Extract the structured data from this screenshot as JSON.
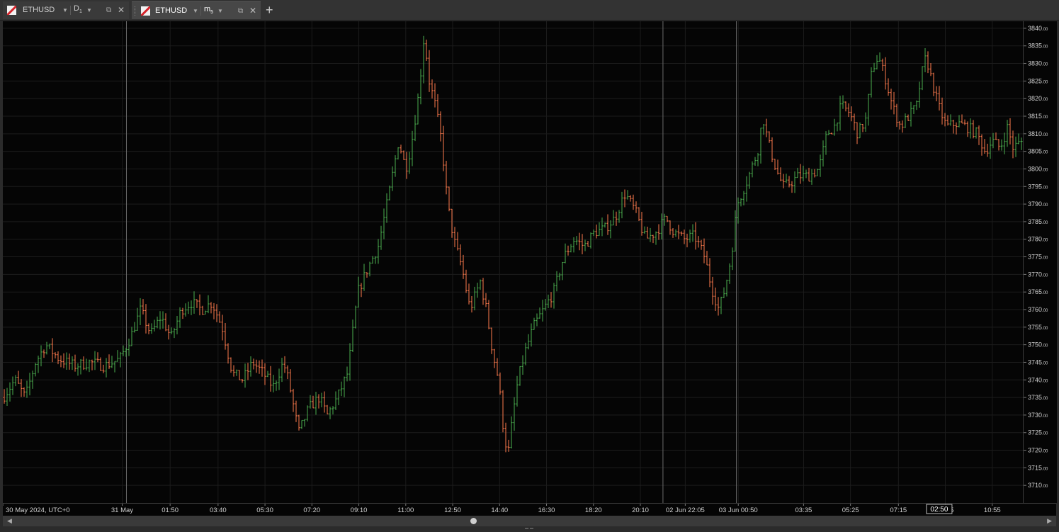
{
  "tabs": [
    {
      "symbol": "ETHUSD",
      "timeframe": "D",
      "timeframe_sub": "1",
      "active": false
    },
    {
      "symbol": "ETHUSD",
      "timeframe": "m",
      "timeframe_sub": "5",
      "active": true
    }
  ],
  "icons": {
    "tab_logo": "eth-logo-icon",
    "dropdown": "chevron-down-icon",
    "popout": "popout-icon",
    "close": "close-icon",
    "add_tab": "plus-icon"
  },
  "symbols": {
    "caret": "▼",
    "popout": "⧉",
    "close": "✕",
    "add": "+",
    "scroll_left": "◀",
    "scroll_right": "▶",
    "grip": "═ ═"
  },
  "colors": {
    "up": "#4caf50",
    "down": "#ff7a4d",
    "background": "#050505",
    "grid": "#1c1c1c"
  },
  "chart_data": {
    "type": "bar",
    "style": "ohlc",
    "symbol": "ETHUSD",
    "timeframe": "m5",
    "ylim": [
      3705,
      3842
    ],
    "y_ticks": [
      "3710.00",
      "3715.00",
      "3720.00",
      "3725.00",
      "3730.00",
      "3735.00",
      "3740.00",
      "3745.00",
      "3750.00",
      "3755.00",
      "3760.00",
      "3765.00",
      "3770.00",
      "3775.00",
      "3780.00",
      "3785.00",
      "3790.00",
      "3795.00",
      "3800.00",
      "3805.00",
      "3810.00",
      "3815.00",
      "3820.00",
      "3825.00",
      "3830.00",
      "3835.00",
      "3840.00"
    ],
    "x_labels": [
      {
        "label": "30 May 2024, UTC+0",
        "at": 0
      },
      {
        "label": "31 May",
        "at": 0.092
      },
      {
        "label": "01:50",
        "at": 0.139
      },
      {
        "label": "03:40",
        "at": 0.186
      },
      {
        "label": "05:30",
        "at": 0.232
      },
      {
        "label": "07:20",
        "at": 0.278
      },
      {
        "label": "09:10",
        "at": 0.324
      },
      {
        "label": "11:00",
        "at": 0.37
      },
      {
        "label": "12:50",
        "at": 0.416
      },
      {
        "label": "14:40",
        "at": 0.462
      },
      {
        "label": "16:30",
        "at": 0.508
      },
      {
        "label": "18:20",
        "at": 0.554
      },
      {
        "label": "20:10",
        "at": 0.6
      },
      {
        "label": "02 Jun 22:05",
        "at": 0.644
      },
      {
        "label": "03 Jun 00:50",
        "at": 0.696
      },
      {
        "label": "03:35",
        "at": 0.76
      },
      {
        "label": "05:25",
        "at": 0.806
      },
      {
        "label": "07:15",
        "at": 0.853
      },
      {
        "label": "09:05",
        "at": 0.899
      },
      {
        "label": "10:55",
        "at": 0.945
      }
    ],
    "session_separators": [
      0.092,
      0.618,
      0.69
    ],
    "cursor_time": "02:50",
    "cursor_at": 0.893,
    "path": [
      [
        0,
        3735
      ],
      [
        0.012,
        3740
      ],
      [
        0.022,
        3735
      ],
      [
        0.032,
        3745
      ],
      [
        0.042,
        3750
      ],
      [
        0.055,
        3746
      ],
      [
        0.07,
        3744
      ],
      [
        0.085,
        3745
      ],
      [
        0.1,
        3744
      ],
      [
        0.115,
        3746
      ],
      [
        0.125,
        3752
      ],
      [
        0.135,
        3760
      ],
      [
        0.145,
        3753
      ],
      [
        0.155,
        3758
      ],
      [
        0.165,
        3752
      ],
      [
        0.175,
        3760
      ],
      [
        0.185,
        3762
      ],
      [
        0.195,
        3760
      ],
      [
        0.205,
        3762
      ],
      [
        0.215,
        3755
      ],
      [
        0.225,
        3742
      ],
      [
        0.235,
        3740
      ],
      [
        0.245,
        3745
      ],
      [
        0.255,
        3742
      ],
      [
        0.265,
        3738
      ],
      [
        0.275,
        3745
      ],
      [
        0.28,
        3740
      ],
      [
        0.29,
        3725
      ],
      [
        0.3,
        3732
      ],
      [
        0.31,
        3735
      ],
      [
        0.318,
        3730
      ],
      [
        0.328,
        3735
      ],
      [
        0.338,
        3742
      ],
      [
        0.348,
        3765
      ],
      [
        0.358,
        3772
      ],
      [
        0.368,
        3778
      ],
      [
        0.378,
        3792
      ],
      [
        0.388,
        3808
      ],
      [
        0.395,
        3800
      ],
      [
        0.4,
        3806
      ],
      [
        0.408,
        3822
      ],
      [
        0.413,
        3838
      ],
      [
        0.418,
        3825
      ],
      [
        0.424,
        3818
      ],
      [
        0.43,
        3808
      ],
      [
        0.436,
        3790
      ],
      [
        0.442,
        3780
      ],
      [
        0.45,
        3772
      ],
      [
        0.458,
        3760
      ],
      [
        0.468,
        3768
      ],
      [
        0.474,
        3760
      ],
      [
        0.48,
        3748
      ],
      [
        0.486,
        3740
      ],
      [
        0.49,
        3728
      ],
      [
        0.495,
        3718
      ],
      [
        0.5,
        3730
      ],
      [
        0.505,
        3740
      ],
      [
        0.512,
        3748
      ],
      [
        0.52,
        3755
      ],
      [
        0.53,
        3760
      ],
      [
        0.54,
        3765
      ],
      [
        0.55,
        3775
      ],
      [
        0.56,
        3780
      ],
      [
        0.57,
        3778
      ],
      [
        0.58,
        3782
      ],
      [
        0.59,
        3783
      ],
      [
        0.6,
        3786
      ],
      [
        0.61,
        3793
      ],
      [
        0.62,
        3788
      ],
      [
        0.63,
        3780
      ],
      [
        0.64,
        3782
      ],
      [
        0.65,
        3786
      ],
      [
        0.658,
        3782
      ],
      [
        0.668,
        3780
      ],
      [
        0.678,
        3781
      ],
      [
        0.688,
        3775
      ],
      [
        0.695,
        3766
      ],
      [
        0.702,
        3760
      ],
      [
        0.708,
        3766
      ],
      [
        0.714,
        3775
      ],
      [
        0.72,
        3790
      ],
      [
        0.73,
        3797
      ],
      [
        0.74,
        3805
      ],
      [
        0.745,
        3815
      ],
      [
        0.75,
        3808
      ],
      [
        0.758,
        3800
      ],
      [
        0.765,
        3795
      ],
      [
        0.772,
        3796
      ],
      [
        0.78,
        3798
      ],
      [
        0.79,
        3798
      ],
      [
        0.8,
        3800
      ],
      [
        0.808,
        3810
      ],
      [
        0.815,
        3812
      ],
      [
        0.822,
        3818
      ],
      [
        0.83,
        3816
      ],
      [
        0.838,
        3810
      ],
      [
        0.846,
        3814
      ],
      [
        0.852,
        3828
      ],
      [
        0.858,
        3832
      ],
      [
        0.865,
        3826
      ],
      [
        0.872,
        3818
      ],
      [
        0.88,
        3812
      ],
      [
        0.888,
        3815
      ],
      [
        0.896,
        3818
      ],
      [
        0.9,
        3826
      ],
      [
        0.905,
        3832
      ],
      [
        0.91,
        3826
      ],
      [
        0.917,
        3818
      ],
      [
        0.925,
        3812
      ],
      [
        0.935,
        3813
      ],
      [
        0.945,
        3812
      ],
      [
        0.955,
        3810
      ],
      [
        0.963,
        3805
      ],
      [
        0.97,
        3808
      ],
      [
        0.978,
        3806
      ],
      [
        0.985,
        3812
      ],
      [
        0.99,
        3806
      ],
      [
        1.0,
        3808
      ]
    ]
  }
}
